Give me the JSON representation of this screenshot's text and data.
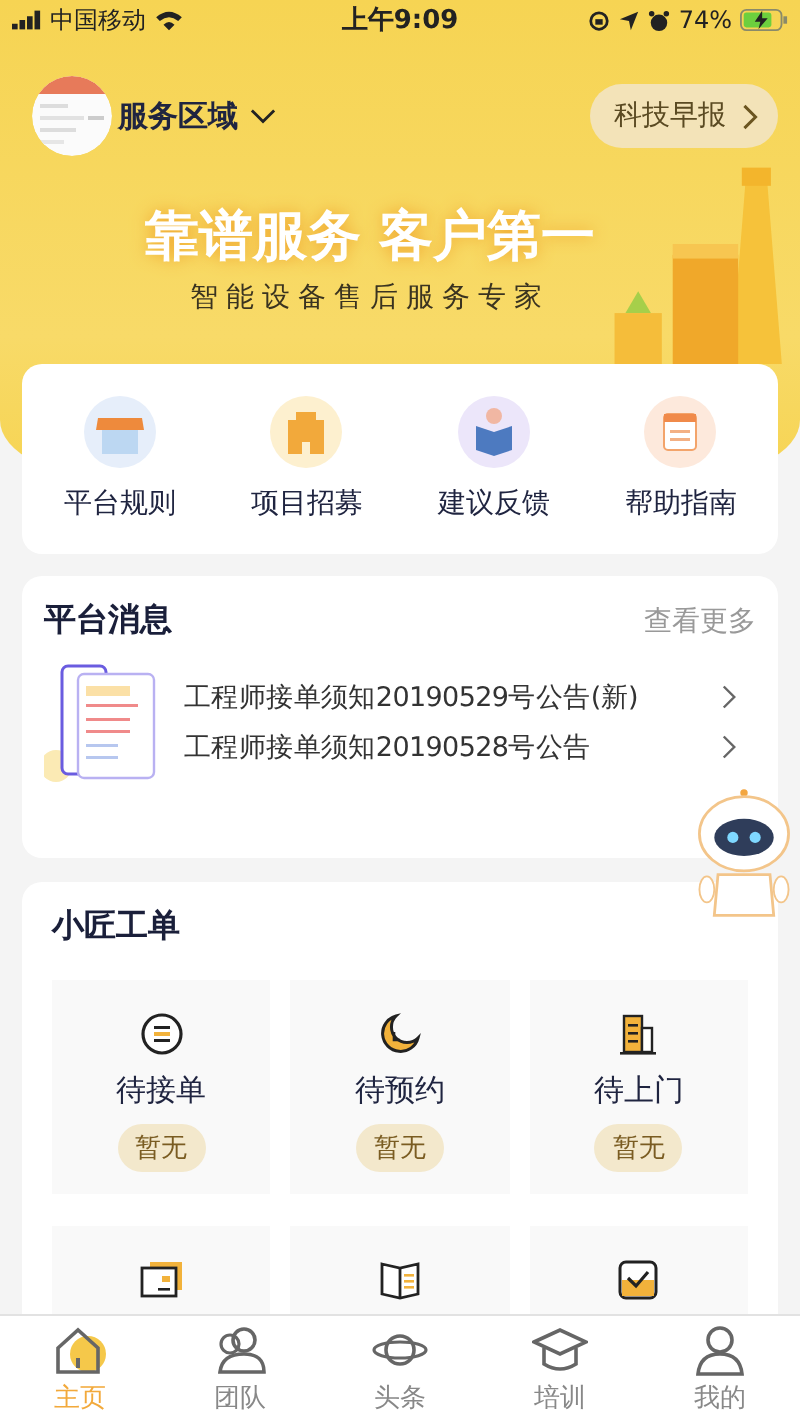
{
  "status_bar": {
    "carrier": "中国移动",
    "time": "上午9:09",
    "battery": "74%"
  },
  "header": {
    "location": "服务区域",
    "news_button": "科技早报"
  },
  "banner": {
    "title": "靠谱服务 客户第一",
    "subtitle": "智能设备售后服务专家"
  },
  "shortcuts": [
    {
      "label": "平台规则",
      "kind": "shop"
    },
    {
      "label": "项目招募",
      "kind": "building"
    },
    {
      "label": "建议反馈",
      "kind": "reader"
    },
    {
      "label": "帮助指南",
      "kind": "calendar"
    }
  ],
  "messages": {
    "title": "平台消息",
    "more": "查看更多",
    "items": [
      "工程师接单须知20190529号公告(新)",
      "工程师接单须知20190528号公告"
    ]
  },
  "orders": {
    "title": "小匠工单",
    "cells": [
      {
        "kind": "list",
        "label": "待接单",
        "badge": "暂无"
      },
      {
        "kind": "moon",
        "label": "待预约",
        "badge": "暂无"
      },
      {
        "kind": "tower",
        "label": "待上门",
        "badge": "暂无"
      },
      {
        "kind": "card"
      },
      {
        "kind": "book"
      },
      {
        "kind": "check"
      }
    ]
  },
  "tab_bar": [
    {
      "label": "主页",
      "kind": "home",
      "selected": true
    },
    {
      "label": "团队",
      "kind": "team",
      "selected": false
    },
    {
      "label": "头条",
      "kind": "planet",
      "selected": false
    },
    {
      "label": "培训",
      "kind": "cap",
      "selected": false
    },
    {
      "label": "我的",
      "kind": "user",
      "selected": false
    }
  ]
}
